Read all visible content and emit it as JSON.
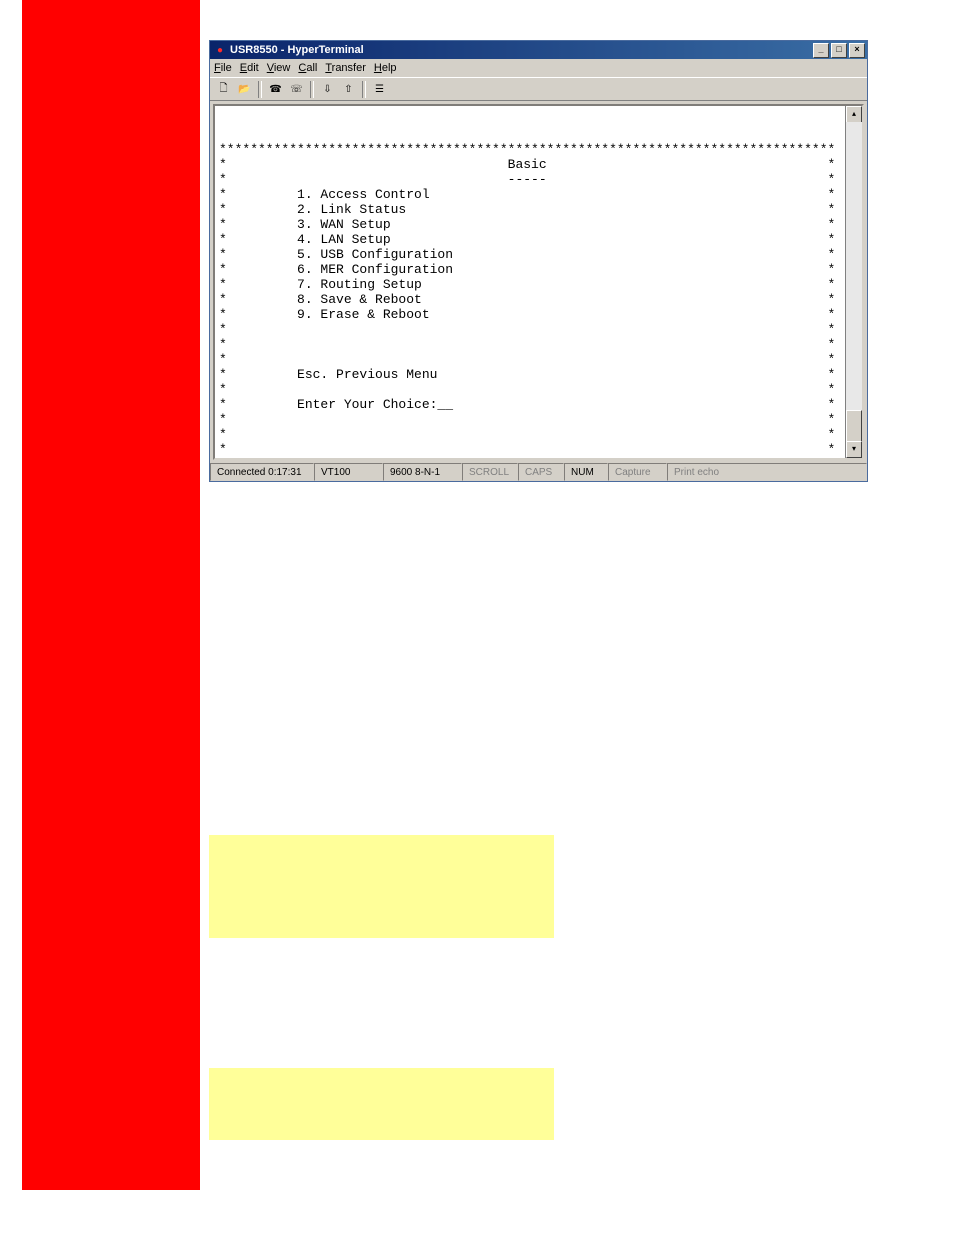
{
  "window": {
    "title": "USR8550 - HyperTerminal",
    "controls": {
      "min": "_",
      "max": "□",
      "close": "×"
    }
  },
  "menu": {
    "file": "File",
    "edit": "Edit",
    "view": "View",
    "call": "Call",
    "transfer": "Transfer",
    "help": "Help"
  },
  "toolbar_icons": {
    "new": "new-file-icon",
    "open": "open-file-icon",
    "connect": "connect-icon",
    "disconnect": "disconnect-icon",
    "send": "send-icon",
    "receive": "receive-icon",
    "properties": "properties-icon"
  },
  "terminal": {
    "title": "Basic",
    "items": [
      "1. Access Control",
      "2. Link Status",
      "3. WAN Setup",
      "4. LAN Setup",
      "5. USB Configuration",
      "6. MER Configuration",
      "7. Routing Setup",
      "8. Save & Reboot",
      "9. Erase & Reboot"
    ],
    "esc": "Esc. Previous Menu",
    "prompt": "Enter Your Choice:__",
    "footer": "Enter Your Choice"
  },
  "status": {
    "connected": "Connected 0:17:31",
    "emulation": "VT100",
    "settings": "9600 8-N-1",
    "scroll": "SCROLL",
    "caps": "CAPS",
    "num": "NUM",
    "capture": "Capture",
    "printecho": "Print echo"
  }
}
